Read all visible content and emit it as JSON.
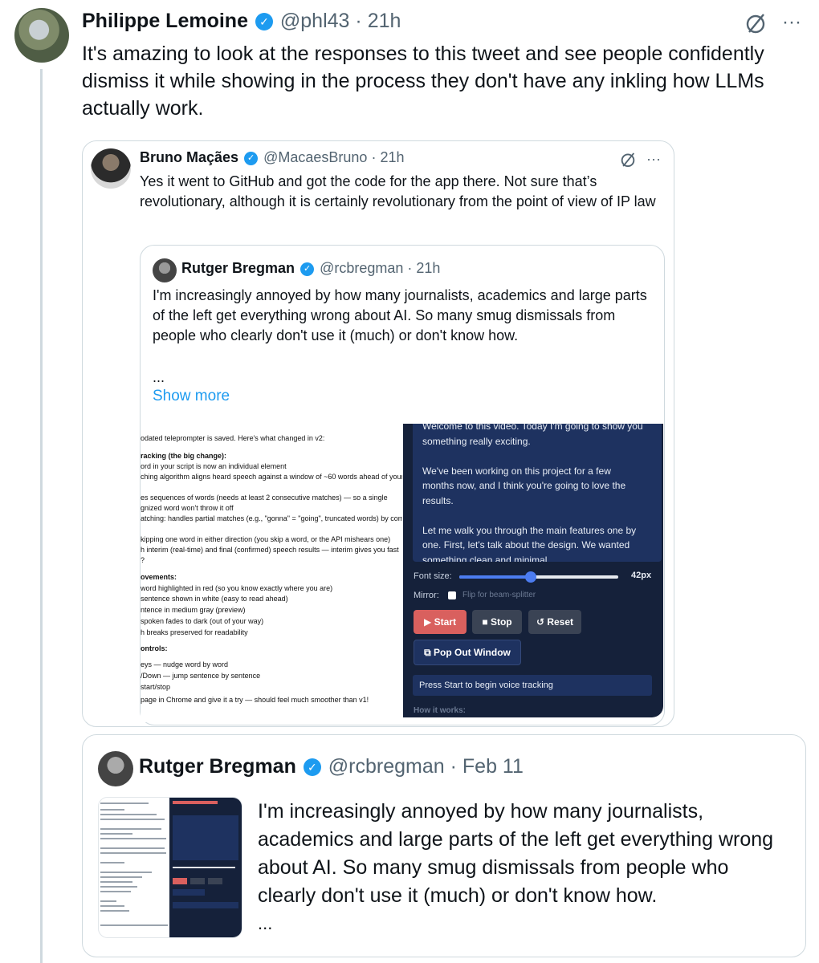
{
  "main_tweet": {
    "name": "Philippe Lemoine",
    "handle": "@phl43",
    "time": "21h",
    "text": "It's amazing to look at the responses to this tweet and see people confidently dismiss it while showing in the process they don't have any inkling how LLMs actually work."
  },
  "quote1": {
    "name": "Bruno Maçães",
    "handle": "@MacaesBruno",
    "time": "21h",
    "text": "Yes it went to GitHub and got the code for the app there. Not sure that’s revolutionary, although it is certainly revolutionary from the point of view of IP law"
  },
  "quote2": {
    "name": "Rutger Bregman",
    "handle": "@rcbregman",
    "time": "21h",
    "text": "I'm increasingly annoyed by how many journalists, academics and large parts of the left get everything wrong about AI. So many smug dismissals from people who clearly don't use it (much) or don't know how.",
    "ellipsis": "...",
    "show_more": "Show more"
  },
  "screenshot_left": {
    "lines": [
      "odated teleprompter is saved. Here's what changed in v2:",
      "racking (the big change):",
      "ord in your script is now an individual element",
      "ching algorithm aligns heard speech against a window of ~60 words ahead of your",
      "es sequences of words (needs at least 2 consecutive matches) — so a single",
      "gnized word won't throw it off",
      "atching: handles partial matches (e.g., \"gonna\" = \"going\", truncated words) by comp",
      "kipping one word in either direction (you skip a word, or the API mishears one)",
      "h interim (real-time) and final (confirmed) speech results — interim gives you fast",
      "?",
      "ovements:",
      "word highlighted in red (so you know exactly where you are)",
      "sentence shown in white (easy to read ahead)",
      "ntence in medium gray (preview)",
      "spoken fades to dark (out of your way)",
      "h breaks preserved for readability",
      "ontrols:",
      "eys — nudge word by word",
      "/Down — jump sentence by sentence",
      "start/stop",
      "page in Chrome and give it a try — should feel much smoother than v1!"
    ]
  },
  "screenshot_right": {
    "script_text": [
      "Welcome to this video. Today I'm going to show you",
      "something really exciting.",
      "",
      "We've been working on this project for a few",
      "months now, and I think you're going to love the",
      "results.",
      "",
      "Let me walk you through the main features one by",
      "one. First, let's talk about the design. We wanted",
      "something clean and minimal"
    ],
    "font_size_label": "Font size:",
    "font_size_value": "42px",
    "font_size_level": 0.45,
    "mirror_label": "Mirror:",
    "mirror_hint": "Flip for beam-splitter",
    "start": "▶ Start",
    "stop": "■ Stop",
    "reset": "↺ Reset",
    "popout": "⧉ Pop Out Window",
    "status": "Press Start to begin voice tracking",
    "how": "How it works:"
  },
  "quote3": {
    "name": "Rutger Bregman",
    "handle": "@rcbregman",
    "time": "Feb 11",
    "text": "I'm increasingly annoyed by how many journalists, academics and large parts of the left get everything wrong about AI. So many smug dismissals from people who clearly don't use it (much) or don't know how.",
    "ellipsis": "..."
  },
  "colors": {
    "link": "#1d9bf0",
    "verified": "#1d9bf0",
    "dark_panel": "#15213a",
    "start_button": "#d9605e"
  },
  "icons": [
    "verified-badge-icon",
    "grok-icon",
    "more-icon",
    "window-icon"
  ],
  "sep": "·",
  "more": "···",
  "check": "✓"
}
